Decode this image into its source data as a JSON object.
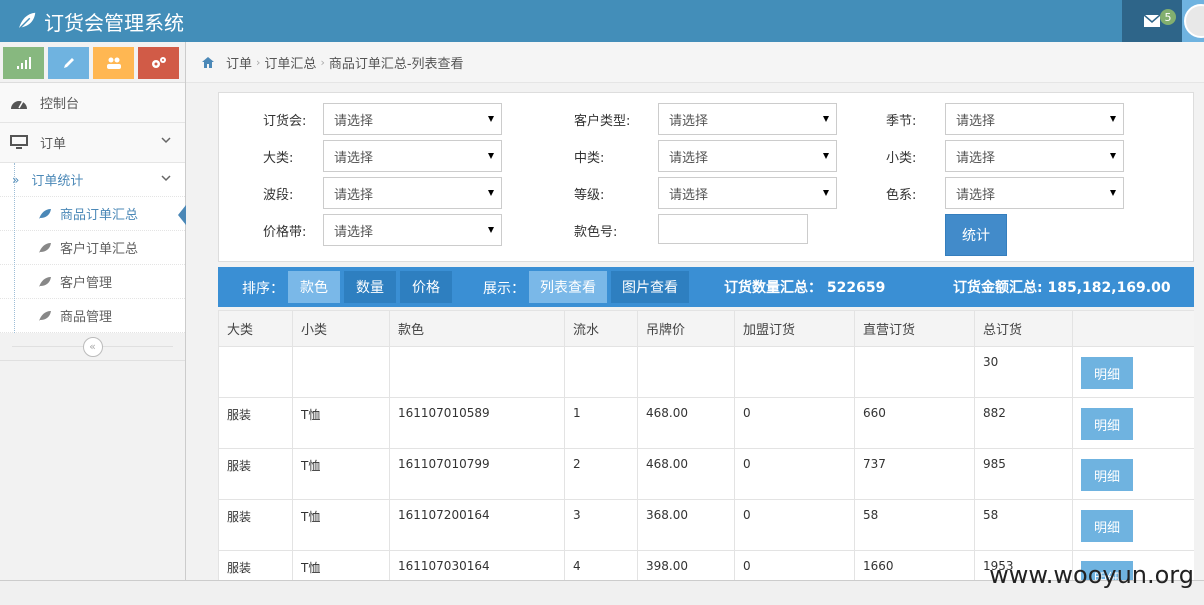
{
  "app": {
    "title": "订货会管理系统",
    "mail_count": "5"
  },
  "colors": {
    "navbar": "#438eb9",
    "accent": "#428bca",
    "bar": "#3a8fd4",
    "detail": "#6fb3e0"
  },
  "sidebar": {
    "shortcuts": [
      "signal-icon",
      "pencil-icon",
      "users-icon",
      "cogs-icon"
    ],
    "items": [
      {
        "label": "控制台",
        "icon": "tachometer-icon"
      },
      {
        "label": "订单",
        "icon": "desktop-icon"
      }
    ],
    "submenu": {
      "label": "订单统计",
      "items": [
        {
          "label": "商品订单汇总",
          "active": true
        },
        {
          "label": "客户订单汇总"
        },
        {
          "label": "客户管理"
        },
        {
          "label": "商品管理"
        }
      ]
    }
  },
  "breadcrumb": [
    "订单",
    "订单汇总",
    "商品订单汇总-列表查看"
  ],
  "filters": {
    "placeholder": "请选择",
    "labels": {
      "order_fair": "订货会:",
      "customer_type": "客户类型:",
      "season": "季节:",
      "category": "大类:",
      "mid_category": "中类:",
      "sub_category": "小类:",
      "wave": "波段:",
      "grade": "等级:",
      "color_series": "色系:",
      "price_band": "价格带:",
      "color_no": "款色号:"
    },
    "submit": "统计"
  },
  "bar": {
    "sort_label": "排序：",
    "sort_tabs": [
      "款色",
      "数量",
      "价格"
    ],
    "view_label": "展示：",
    "view_tabs": [
      "列表查看",
      "图片查看"
    ],
    "qty_label": "订货数量汇总：",
    "qty_value": "522659",
    "amount_label": "订货金额汇总:",
    "amount_value": "185,182,169.00"
  },
  "table": {
    "headers": [
      "大类",
      "小类",
      "款色",
      "流水",
      "吊牌价",
      "加盟订货",
      "直营订货",
      "总订货",
      ""
    ],
    "detail_label": "明细",
    "rows": [
      [
        "",
        "",
        "",
        "",
        "",
        "",
        "",
        "30"
      ],
      [
        "服装",
        "T恤",
        "161107010589",
        "1",
        "468.00",
        "0",
        "660",
        "882"
      ],
      [
        "服装",
        "T恤",
        "161107010799",
        "2",
        "468.00",
        "0",
        "737",
        "985"
      ],
      [
        "服装",
        "T恤",
        "161107200164",
        "3",
        "368.00",
        "0",
        "58",
        "58"
      ],
      [
        "服装",
        "T恤",
        "161107030164",
        "4",
        "398.00",
        "0",
        "1660",
        "1953"
      ]
    ]
  },
  "watermark": "www.wooyun.org"
}
